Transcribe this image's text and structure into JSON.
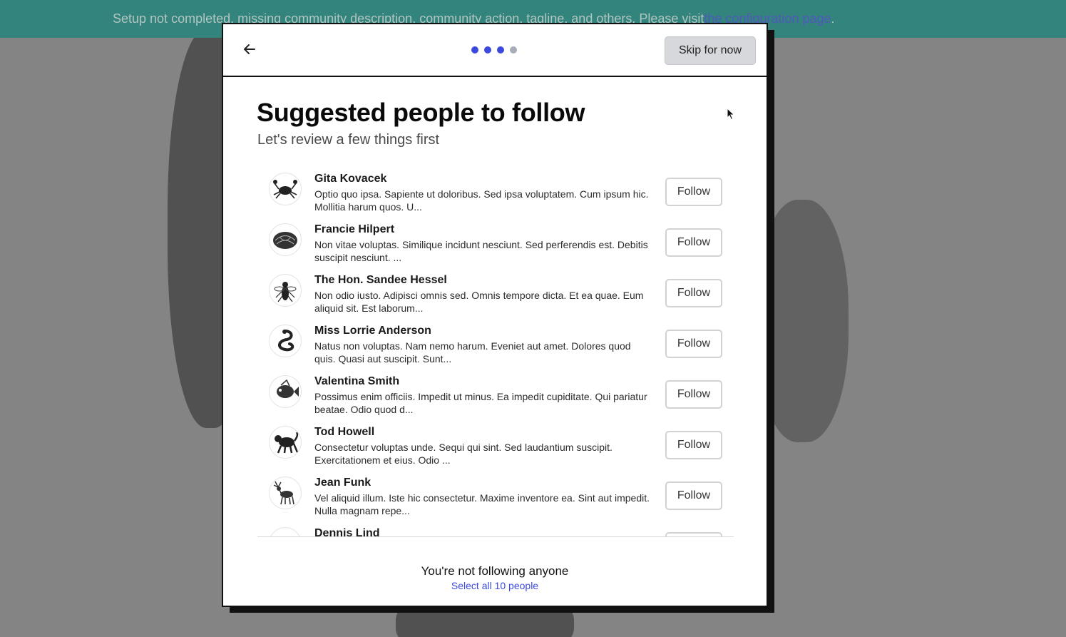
{
  "banner": {
    "text": "Setup not completed, missing community description, community action, tagline, and others. Please visit ",
    "link": "the configuration page",
    "suffix": "."
  },
  "modal": {
    "skip_label": "Skip for now",
    "step_indicator": {
      "total": 4,
      "active": 3
    },
    "title": "Suggested people to follow",
    "subtitle": "Let's review a few things first",
    "people": [
      {
        "name": "Gita Kovacek",
        "bio": "Optio quo ipsa. Sapiente ut doloribus. Sed ipsa voluptatem. Cum ipsum hic. Mollitia harum quos. U...",
        "follow_label": "Follow",
        "avatar_icon": "crab-icon"
      },
      {
        "name": "Francie Hilpert",
        "bio": "Non vitae voluptas. Similique incidunt nesciunt. Sed perferendis est. Debitis suscipit nesciunt. ...",
        "follow_label": "Follow",
        "avatar_icon": "coral-icon"
      },
      {
        "name": "The Hon. Sandee Hessel",
        "bio": "Non odio iusto. Adipisci omnis sed. Omnis tempore dicta. Et ea quae. Eum aliquid sit. Est laborum...",
        "follow_label": "Follow",
        "avatar_icon": "fly-icon"
      },
      {
        "name": "Miss Lorrie Anderson",
        "bio": "Natus non voluptas. Nam nemo harum. Eveniet aut amet. Dolores quod quis. Quasi aut suscipit. Sunt...",
        "follow_label": "Follow",
        "avatar_icon": "snake-icon"
      },
      {
        "name": "Valentina Smith",
        "bio": "Possimus enim officiis. Impedit ut minus. Ea impedit cupiditate. Qui pariatur beatae. Odio quod d...",
        "follow_label": "Follow",
        "avatar_icon": "fish-icon"
      },
      {
        "name": "Tod Howell",
        "bio": "Consectetur voluptas unde. Sequi qui sint. Sed laudantium suscipit. Exercitationem et eius. Odio ...",
        "follow_label": "Follow",
        "avatar_icon": "monkey-icon"
      },
      {
        "name": "Jean Funk",
        "bio": "Vel aliquid illum. Iste hic consectetur. Maxime inventore ea. Sint aut impedit. Nulla magnam repe...",
        "follow_label": "Follow",
        "avatar_icon": "deer-icon"
      },
      {
        "name": "Dennis Lind",
        "bio": "",
        "follow_label": "",
        "avatar_icon": "animal-icon"
      }
    ],
    "status_text": "You're not following anyone",
    "select_all_label": "Select all 10 people"
  },
  "colors": {
    "accent": "#3b49df",
    "banner": "#0d8a7e",
    "inactive_dot": "#a8adb8"
  }
}
